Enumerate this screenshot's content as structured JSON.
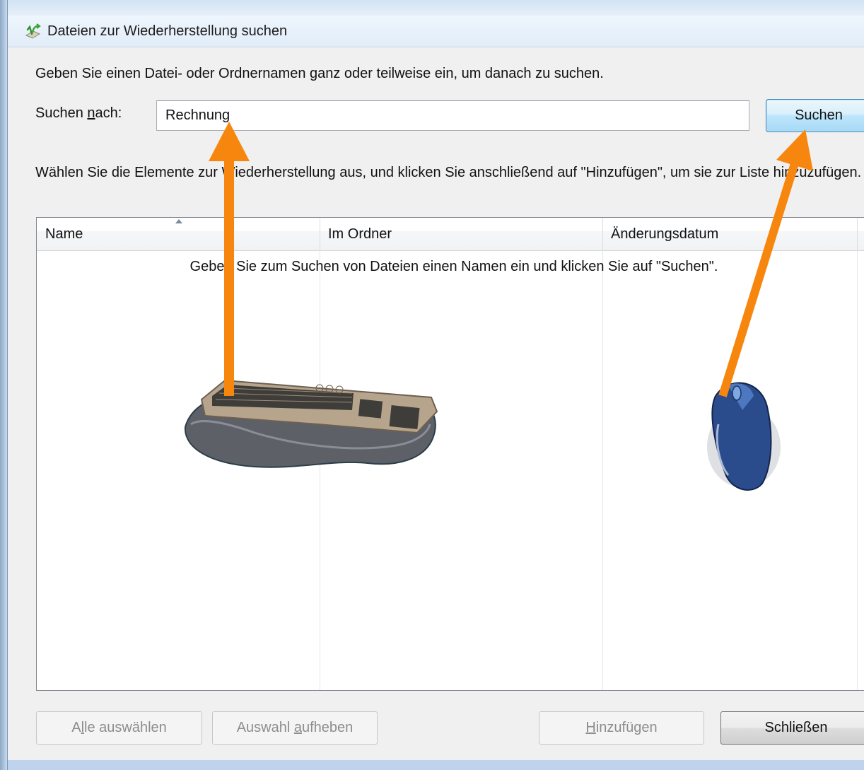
{
  "window": {
    "title": "Dateien zur Wiederherstellung suchen"
  },
  "instruction": "Geben Sie einen Datei- oder Ordnernamen ganz oder teilweise ein, um danach zu suchen.",
  "search": {
    "label_pre": "Suchen ",
    "label_accel": "n",
    "label_post": "ach:",
    "value": "Rechnung",
    "button": "Suchen"
  },
  "select_instruction": "Wählen Sie die Elemente zur Wiederherstellung aus, und klicken Sie anschließend auf \"Hinzufügen\", um sie zur Liste hinzuzufügen.",
  "list": {
    "columns": [
      "Name",
      "Im Ordner",
      "Änderungsdatum"
    ],
    "empty_message": "Geben Sie zum Suchen von Dateien einen Namen ein und klicken Sie auf \"Suchen\"."
  },
  "buttons": {
    "select_all": {
      "pre": "A",
      "accel": "l",
      "post": "le auswählen"
    },
    "deselect": {
      "pre": "Auswahl ",
      "accel": "a",
      "post": "ufheben"
    },
    "add": {
      "pre": "",
      "accel": "H",
      "post": "inzufügen"
    },
    "close": "Schließen"
  },
  "colors": {
    "arrow": "#f7860f",
    "window_frame": "#b9d1ea",
    "client": "#f0f0f0",
    "search_button": "#bee6fd"
  }
}
